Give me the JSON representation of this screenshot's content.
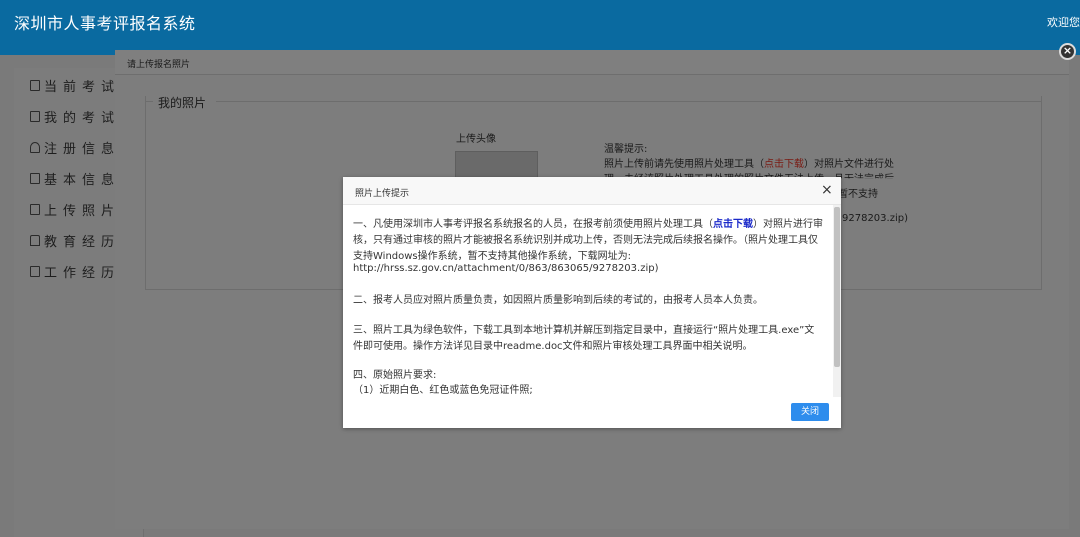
{
  "header": {
    "title": "深圳市人事考评报名系统",
    "welcome": "欢迎您"
  },
  "sidebar": {
    "items": [
      {
        "label": "当前考试",
        "icon": "doc-icon"
      },
      {
        "label": "我的考试",
        "icon": "doc-icon"
      },
      {
        "label": "注册信息",
        "icon": "user-icon"
      },
      {
        "label": "基本信息",
        "icon": "card-icon"
      },
      {
        "label": "上传照片",
        "icon": "image-icon"
      },
      {
        "label": "教育经历",
        "icon": "cap-icon"
      },
      {
        "label": "工作经历",
        "icon": "briefcase-icon"
      }
    ]
  },
  "dialog": {
    "title": "请上传报名照片",
    "legend": "我的照片",
    "avatar_label": "上传头像",
    "tip_title": "温馨提示:",
    "tip_line1_a": "照片上传前请先使用照片处理工具（",
    "tip_line1_link": "点击下载",
    "tip_line1_b": "）对照片文件进行处",
    "tip_line2": "理，未经该照片处理工具处理的照片文件无法上传，且无法完成后",
    "bg_tail1": "统，暂不支持",
    "bg_tail2": "9278203.zip)"
  },
  "popup": {
    "title": "照片上传提示",
    "close_glyph": "×",
    "p1_a": "一、凡使用深圳市人事考评报名系统报名的人员，在报考前须使用照片处理工具（",
    "p1_link": "点击下载",
    "p1_b": "）对照片进行审",
    "p1_line2": "核，只有通过审核的照片才能被报名系统识别并成功上传，否则无法完成后续报名操作。（照片处理工具仅",
    "p1_line3": "支持Windows操作系统，暂不支持其他操作系统，下载网址为:",
    "p1_line4": "http://hrss.sz.gov.cn/attachment/0/863/863065/9278203.zip)",
    "p2": "二、报考人员应对照片质量负责，如因照片质量影响到后续的考试的，由报考人员本人负责。",
    "p3_line1": "三、照片工具为绿色软件，下载工具到本地计算机并解压到指定目录中，直接运行“照片处理工具.exe”文",
    "p3_line2": "件即可使用。操作方法详见目录中readme.doc文件和照片审核处理工具界面中相关说明。",
    "p4_line1": "四、原始照片要求:",
    "p4_line2": "（1）近期白色、红色或蓝色免冠证件照;",
    "button_label": "关闭"
  },
  "dialog_close_glyph": "×"
}
